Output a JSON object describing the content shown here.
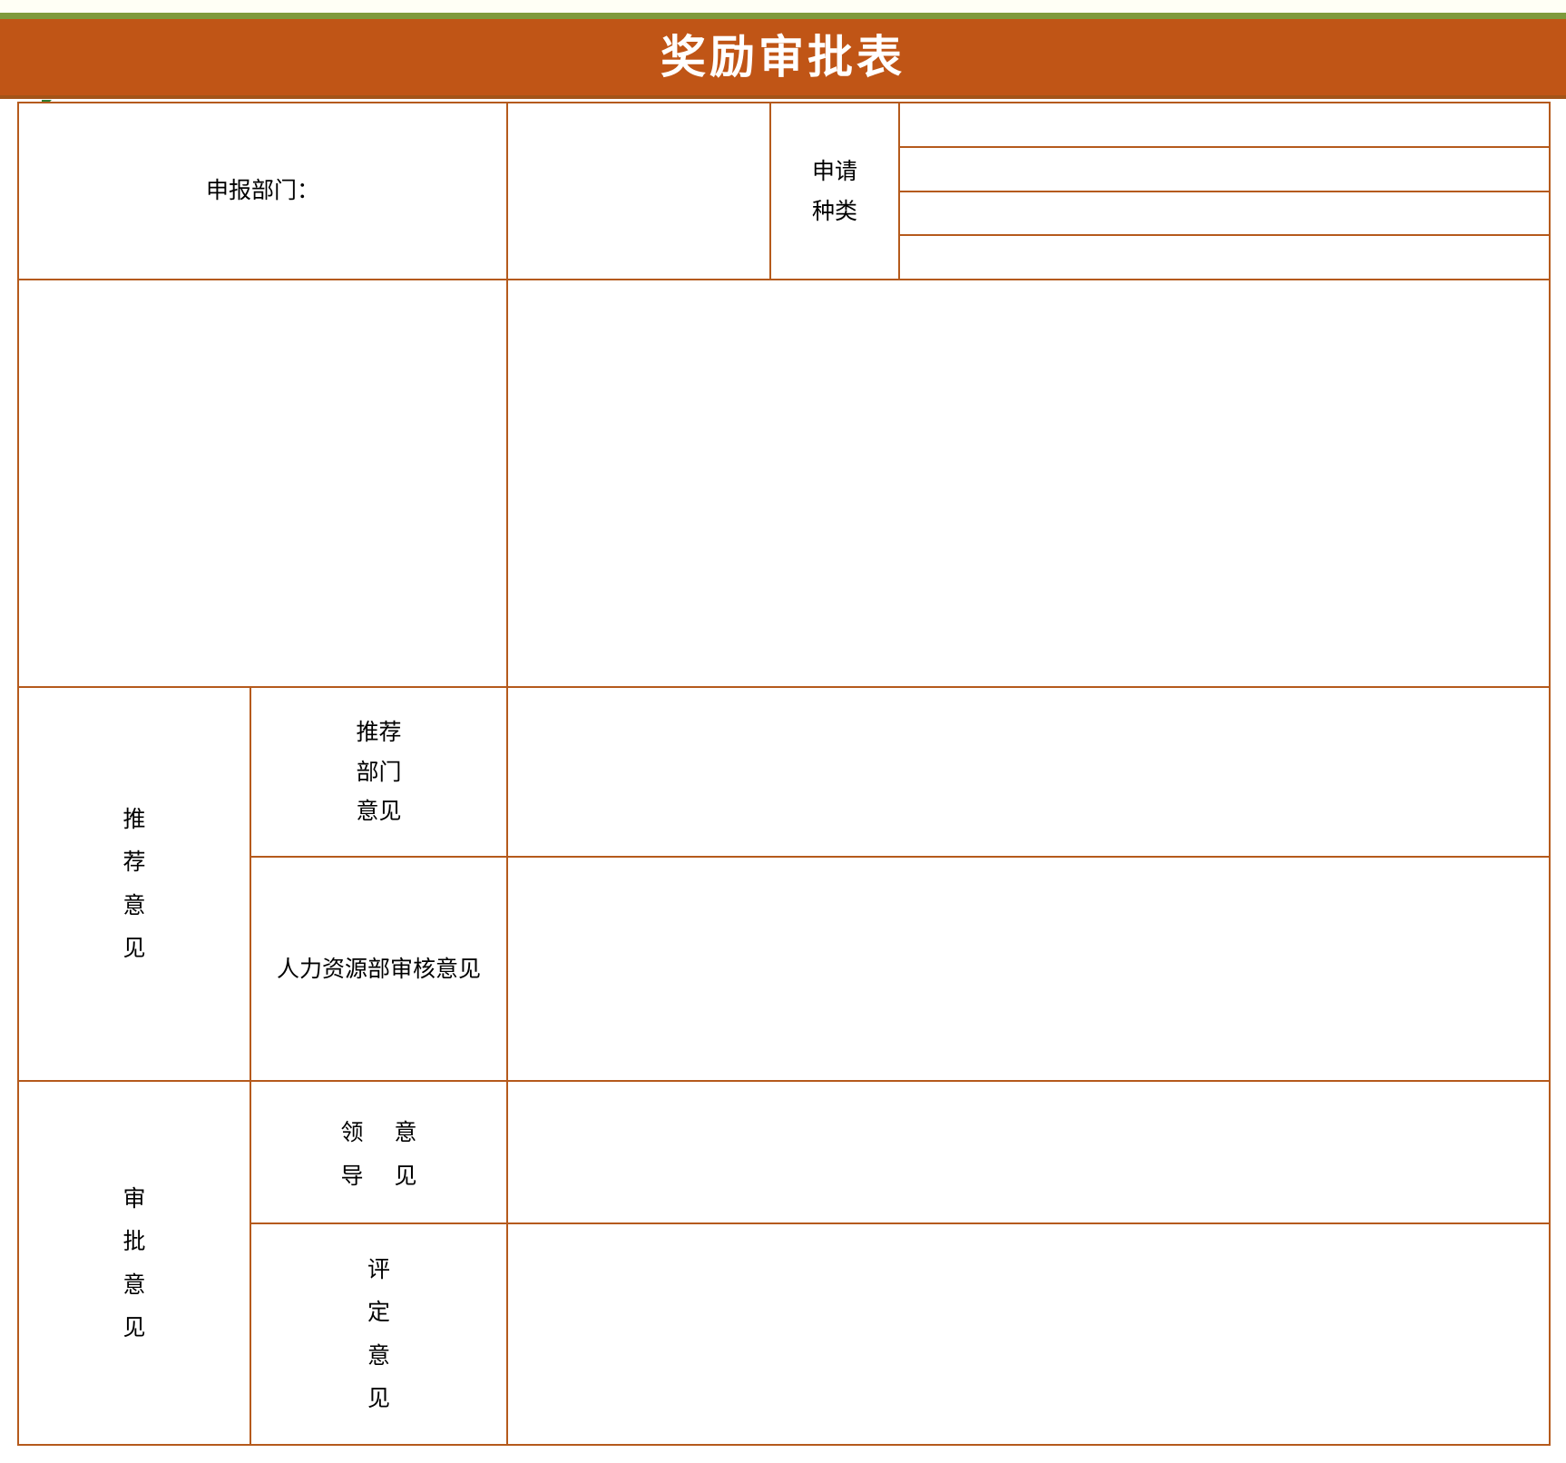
{
  "document": {
    "title": "奖励审批表",
    "accent_color": "#C05516",
    "border_color": "#B55A1C",
    "rule_color": "#7E9A3C",
    "title_color": "#FFFFFF",
    "marker": "comment-marker"
  },
  "form": {
    "rows": {
      "department": {
        "label": "申报部门：",
        "value": "",
        "kind_label_chars": [
          "申请",
          "种类"
        ],
        "kind_options": [
          "",
          "",
          "",
          ""
        ]
      },
      "content": {
        "left_value": "",
        "right_value": ""
      },
      "recommendation": {
        "group_label_chars": [
          "推",
          "荐",
          "意",
          "见"
        ],
        "items": [
          {
            "label_chars": [
              "推荐",
              "部门",
              "意见"
            ],
            "label_text": "推荐部门意见",
            "value": ""
          },
          {
            "label_text": "人力资源部审核意见",
            "value": ""
          }
        ]
      },
      "approval": {
        "group_label_chars": [
          "审",
          "批",
          "意",
          "见"
        ],
        "items": [
          {
            "label_pairs": [
              "领",
              "意",
              "导",
              "见"
            ],
            "label_text": "领导意见",
            "value": ""
          },
          {
            "label_chars": [
              "评",
              "定",
              "意",
              "见"
            ],
            "label_text": "评定意见",
            "value": ""
          }
        ]
      }
    }
  }
}
